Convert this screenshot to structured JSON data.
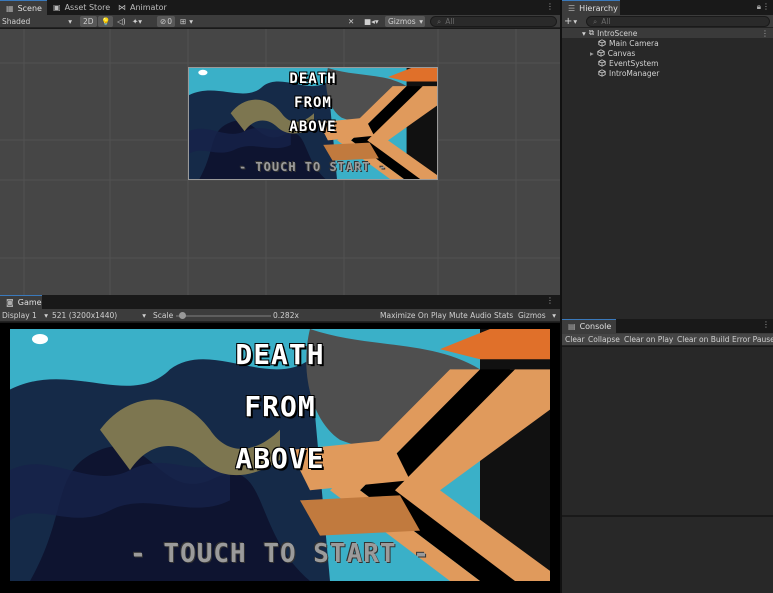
{
  "scene_panel": {
    "tabs": [
      {
        "label": "Scene",
        "icon": "grid-icon"
      },
      {
        "label": "Asset Store",
        "icon": "store-icon"
      },
      {
        "label": "Animator",
        "icon": "animator-icon"
      }
    ],
    "toolbar": {
      "shading_mode": "Shaded",
      "mode_2d": "2D",
      "hidden_count": "0",
      "gizmos_label": "Gizmos",
      "search_placeholder": "All"
    }
  },
  "game_panel": {
    "tab_label": "Game",
    "toolbar": {
      "display": "Display 1",
      "resolution": "521 (3200x1440)",
      "scale_label": "Scale",
      "scale_value": "0.282x",
      "scale_fraction": 0.03,
      "maximize_on_play": "Maximize On Play",
      "mute_audio": "Mute Audio",
      "stats": "Stats",
      "gizmos": "Gizmos"
    }
  },
  "game_art": {
    "title_lines": [
      "DEATH",
      "FROM",
      "ABOVE"
    ],
    "start_prompt_scene": "- TOUCH TO START -",
    "start_prompt_game": "- TOUCH TO START -"
  },
  "hierarchy": {
    "tab_label": "Hierarchy",
    "search_placeholder": "All",
    "scene_name": "IntroScene",
    "objects": [
      {
        "name": "Main Camera",
        "expandable": false
      },
      {
        "name": "Canvas",
        "expandable": true
      },
      {
        "name": "EventSystem",
        "expandable": false
      },
      {
        "name": "IntroManager",
        "expandable": false
      }
    ]
  },
  "console": {
    "tab_label": "Console",
    "buttons": [
      "Clear",
      "Collapse",
      "Clear on Play",
      "Clear on Build",
      "Error Pause"
    ]
  },
  "colors": {
    "editor_bg": "#191919",
    "panel_bg": "#3c3c3c",
    "scene_bg": "#464646",
    "sky_blue": "#3ab0c8",
    "arrow_orange": "#e09a5c",
    "accent_blue": "#3a79bb"
  }
}
